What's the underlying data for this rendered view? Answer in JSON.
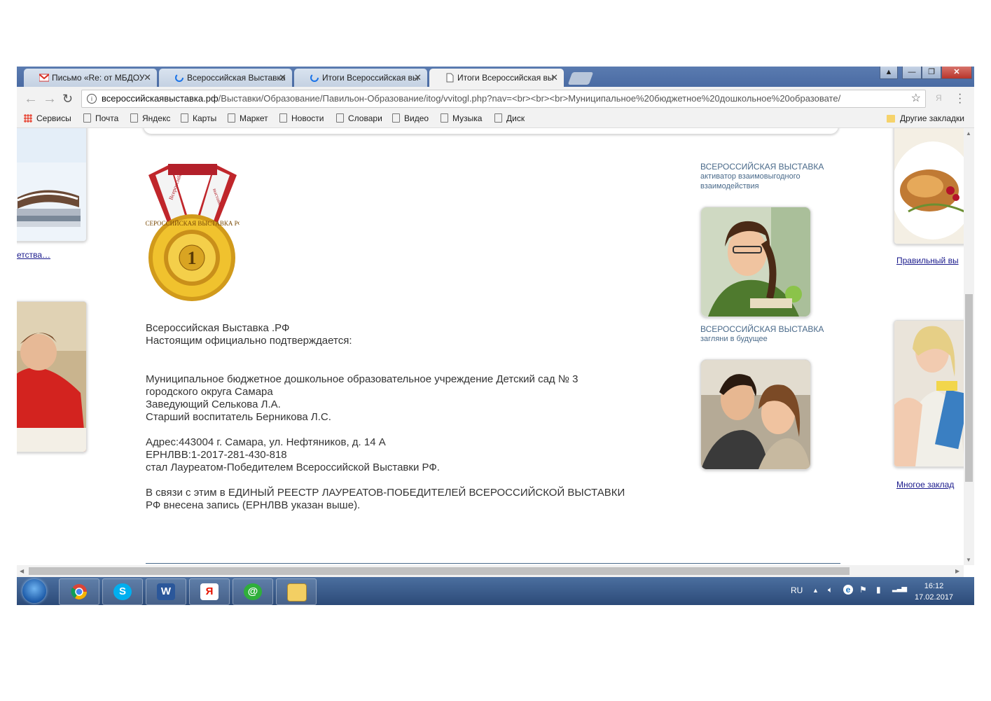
{
  "tabs": [
    {
      "title": "Письмо «Re: от МБДОУ",
      "icon": "gmail-icon"
    },
    {
      "title": "Всероссийская Выставка",
      "icon": "loading-icon"
    },
    {
      "title": "Итоги Всероссийская вы",
      "icon": "loading-icon"
    },
    {
      "title": "Итоги Всероссийская вы",
      "icon": "page-icon"
    }
  ],
  "address": {
    "host": "всероссийскаявыставка.рф",
    "path": "/Выставки/Образование/Павильон-Образование/itog/vvitogl.php?nav=<br><br><br>Муниципальное%20бюджетное%20дошкольное%20образовате/"
  },
  "bookmarks": [
    "Сервисы",
    "Почта",
    "Яндекс",
    "Карты",
    "Маркет",
    "Новости",
    "Словари",
    "Видео",
    "Музыка",
    "Диск"
  ],
  "other_bookmarks": "Другие закладки",
  "left_link": "етства…",
  "right_links": [
    "Правильный вы",
    "Многое заклад"
  ],
  "certificate": {
    "header": [
      "Всероссийская Выставка .РФ",
      "Настоящим официально подтверждается:"
    ],
    "org": [
      "Муниципальное бюджетное дошкольное образовательное учреждение Детский сад № 3",
      "городского округа Самара",
      "Заведующий Селькова Л.А.",
      "Старший воспитатель Берникова Л.С."
    ],
    "details": [
      "Адрес:443004 г. Самара, ул. Нефтяников, д. 14 А",
      "ЕРНЛВВ:1-2017-281-430-818",
      "стал Лауреатом-Победителем Всероссийской Выставки РФ."
    ],
    "registry": [
      "В связи с этим в ЕДИНЫЙ РЕЕСТР ЛАУРЕАТОВ-ПОБЕДИТЕЛЕЙ ВСЕРОССИЙСКОЙ ВЫСТАВКИ",
      "РФ внесена запись (ЕРНЛВВ указан выше)."
    ]
  },
  "medal": {
    "ribbon_text": "Всероссийская",
    "ring_text": "ВСЕРОССИЙСКАЯ ВЫСТАВКА РФ",
    "number": "1"
  },
  "promo": [
    {
      "title": "ВСЕРОССИЙСКАЯ ВЫСТАВКА",
      "sub": [
        "активатор взаимовыгодного",
        "взаимодействия"
      ]
    },
    {
      "title": "ВСЕРОССИЙСКАЯ ВЫСТАВКА",
      "sub": [
        "загляни в будущее"
      ]
    }
  ],
  "tray": {
    "lang": "RU",
    "time": "16:12",
    "date": "17.02.2017"
  },
  "taskbar_apps": [
    "chrome-icon",
    "skype-icon",
    "word-icon",
    "yandex-icon",
    "mail-agent-icon",
    "explorer-icon"
  ]
}
